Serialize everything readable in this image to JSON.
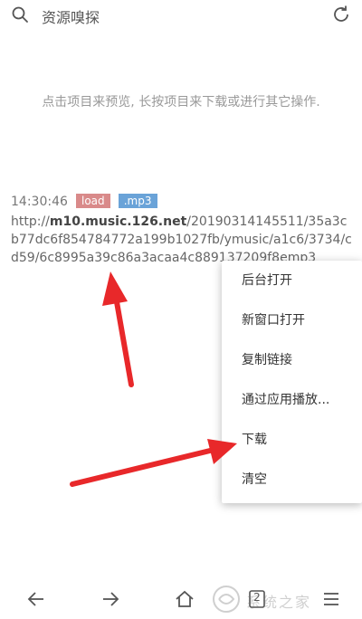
{
  "header": {
    "title": "资源嗅探"
  },
  "hint": "点击项目来预览, 长按项目来下载或进行其它操作.",
  "entry": {
    "time": "14:30:46",
    "status_badge": "load",
    "type_badge": ".mp3",
    "url_prefix": "http://",
    "url_host": "m10.music.126.net",
    "url_path": "/20190314145511/35a3cb77dc6f854784772a199b1027fb/ymusic/a1c6/3734/cd59/6c8995a39c86a3acaa4c889137209f8emp3"
  },
  "context_menu": {
    "items": [
      "后台打开",
      "新窗口打开",
      "复制链接",
      "通过应用播放...",
      "下载",
      "清空"
    ]
  },
  "bottom_nav": {
    "tab_count": "2"
  },
  "watermark": {
    "text": "系统之家"
  },
  "colors": {
    "badge_load": "#d98a8a",
    "badge_type": "#6aa3d8",
    "arrow": "#e8282a"
  }
}
